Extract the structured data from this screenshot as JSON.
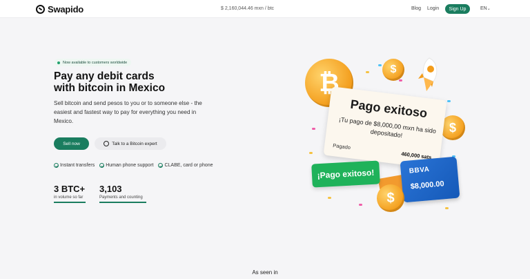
{
  "header": {
    "logo_text": "Swapido",
    "rate": "$ 2,160,044.46 mxn / btc",
    "nav": {
      "blog": "Blog",
      "login": "Login",
      "signup": "Sign Up",
      "lang": "EN"
    }
  },
  "hero": {
    "availability": "Now available to customers worldwide",
    "title_line1": "Pay any debit cards",
    "title_line2": "with bitcoin in Mexico",
    "subtitle": "Sell bitcoin and send pesos to you or to someone else - the easiest and fastest way to pay for everything you need in Mexico.",
    "sell_button": "Sell now",
    "talk_button": "Talk to a Bitcoin expert",
    "features": [
      "Instant transfers",
      "Human phone support",
      "CLABE, card or phone"
    ],
    "stats": [
      {
        "value": "3 BTC+",
        "label": "in volume so far"
      },
      {
        "value": "3,103",
        "label": "Payments and counting"
      }
    ]
  },
  "illustration": {
    "card_title": "Pago exitoso",
    "card_message": "¡Tu pago de $8,000,00 mxn ha sido depositado!",
    "card_status": "Pagado",
    "card_sats": "460,000 sats",
    "pill_text": "¡Pago exitoso!",
    "bank_name": "BBVA",
    "bank_amount": "$8,000.00",
    "bitcoin_symbol": "₿",
    "dollar_symbol": "$"
  },
  "seen_in": "As seen in",
  "colors": {
    "brand": "#1a7d5f",
    "coin": "#f39c1a",
    "bbva": "#1559b8",
    "success": "#1fb25a"
  }
}
